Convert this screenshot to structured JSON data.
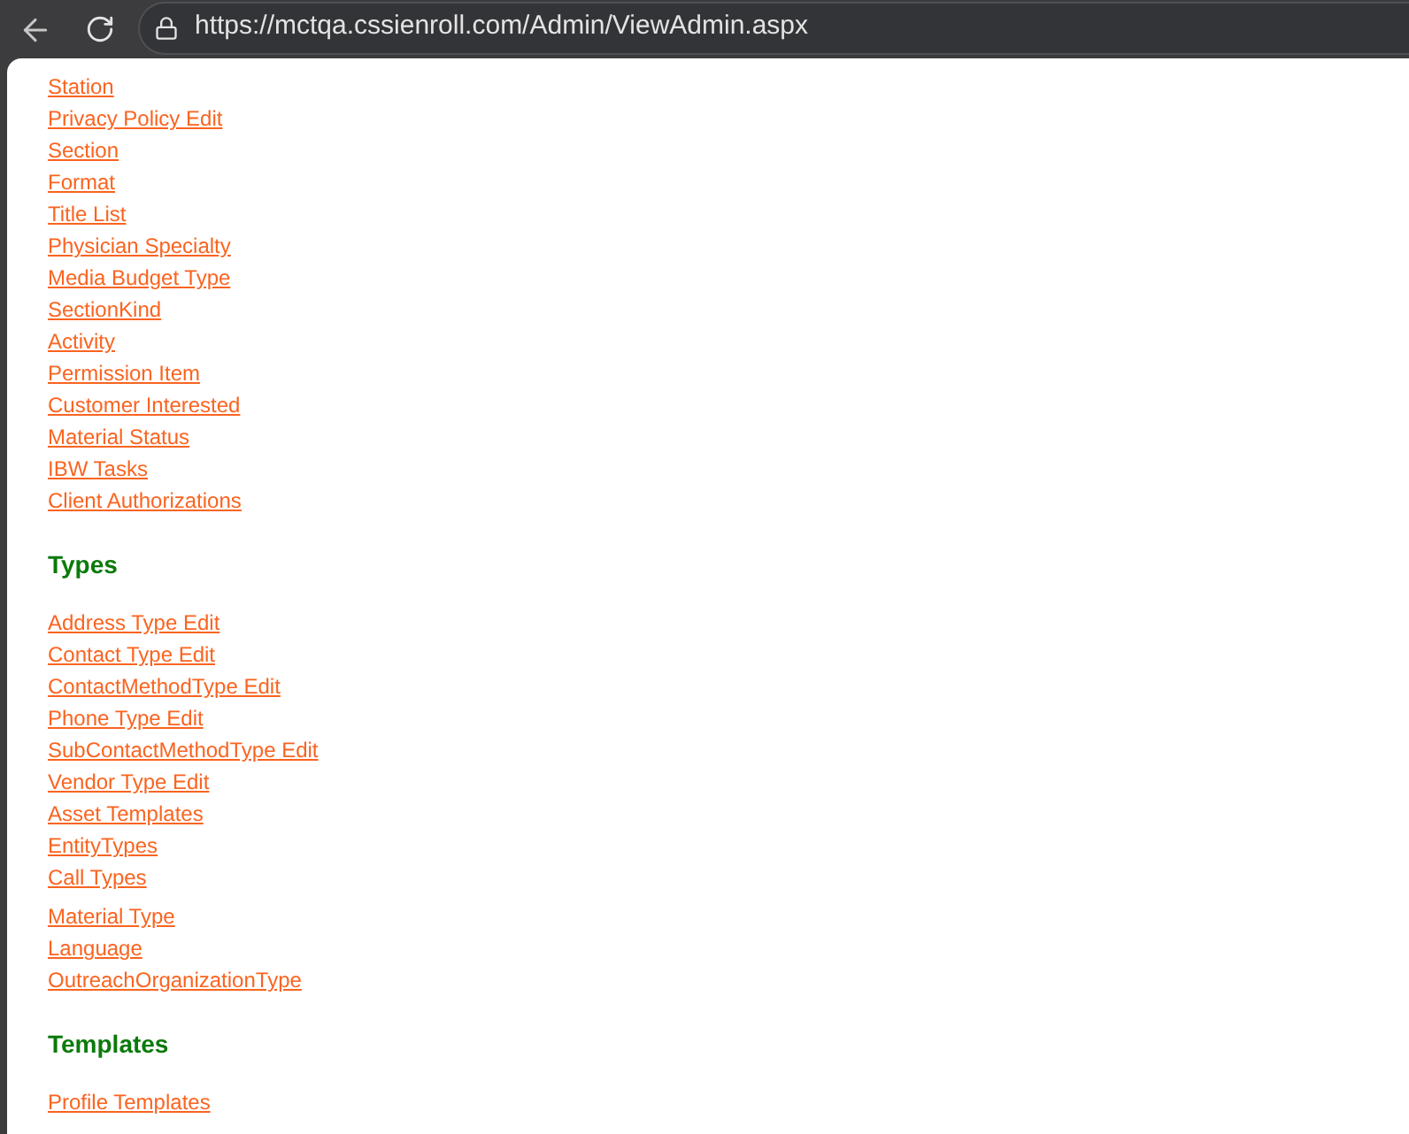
{
  "browser": {
    "url": "https://mctqa.cssienroll.com/Admin/ViewAdmin.aspx"
  },
  "sections": [
    {
      "groups": [
        [
          "Station",
          "Privacy Policy Edit",
          "Section",
          "Format",
          "Title List",
          "Physician Specialty",
          "Media Budget Type",
          "SectionKind",
          "Activity",
          "Permission Item",
          "Customer Interested",
          "Material Status",
          "IBW Tasks",
          "Client Authorizations"
        ]
      ]
    },
    {
      "heading": "Types",
      "groups": [
        [
          "Address Type Edit",
          "Contact Type Edit",
          "ContactMethodType Edit",
          "Phone Type Edit",
          "SubContactMethodType Edit",
          "Vendor Type Edit",
          "Asset Templates",
          "EntityTypes",
          "Call Types"
        ],
        [
          "Material Type",
          "Language",
          "OutreachOrganizationType"
        ]
      ]
    },
    {
      "heading": "Templates",
      "groups": [
        [
          "Profile Templates"
        ]
      ]
    }
  ]
}
